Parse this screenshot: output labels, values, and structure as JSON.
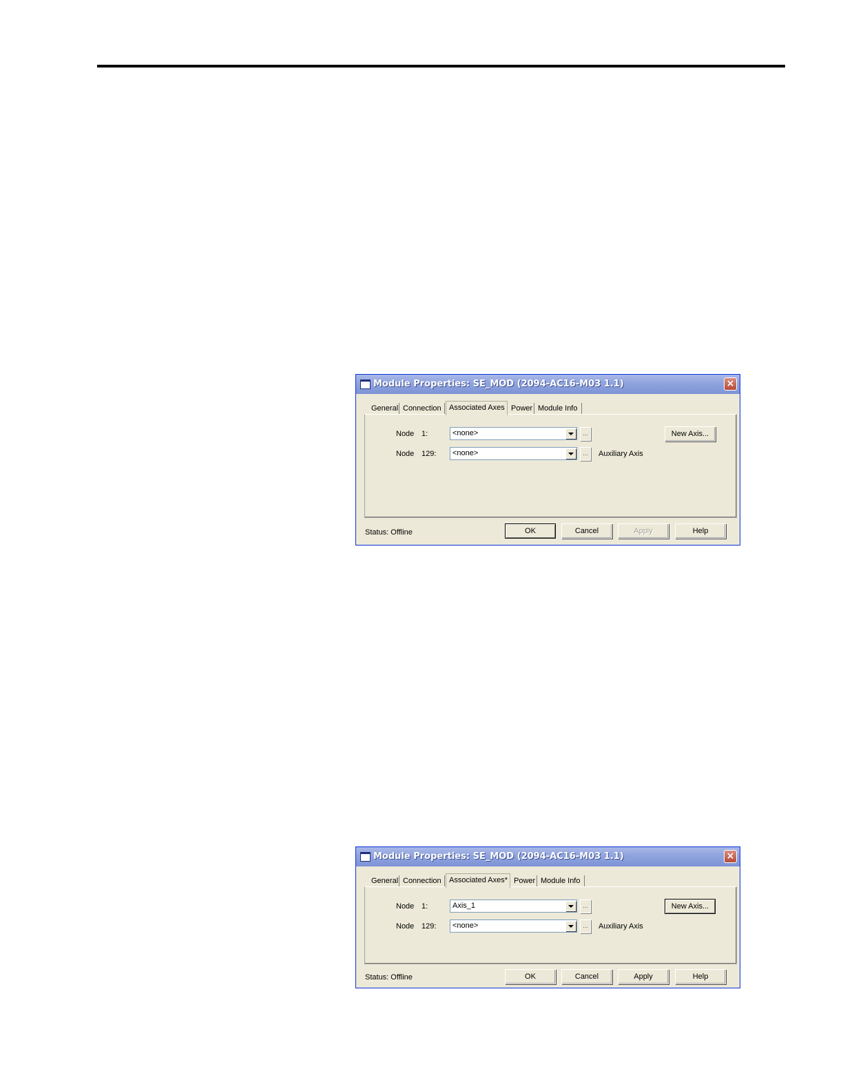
{
  "dialogs": [
    {
      "title": "Module Properties: SE_MOD (2094-AC16-M03 1.1)",
      "tabs": [
        "General",
        "Connection",
        "Associated Axes",
        "Power",
        "Module Info"
      ],
      "node1": {
        "label": "Node",
        "number": "1:",
        "value": "<none>"
      },
      "node129": {
        "label": "Node",
        "number": "129:",
        "value": "<none>",
        "note": "Auxiliary Axis"
      },
      "new_axis_label": "New Axis...",
      "ellipsis": "...",
      "status": "Status:  Offline",
      "buttons": {
        "ok": "OK",
        "cancel": "Cancel",
        "apply": "Apply",
        "help": "Help"
      },
      "close": "×"
    },
    {
      "title": "Module Properties: SE_MOD (2094-AC16-M03 1.1)",
      "tabs": [
        "General",
        "Connection",
        "Associated Axes*",
        "Power",
        "Module Info"
      ],
      "node1": {
        "label": "Node",
        "number": "1:",
        "value": "Axis_1"
      },
      "node129": {
        "label": "Node",
        "number": "129:",
        "value": "<none>",
        "note": "Auxiliary Axis"
      },
      "new_axis_label": "New Axis...",
      "ellipsis": "...",
      "status": "Status:  Offline",
      "buttons": {
        "ok": "OK",
        "cancel": "Cancel",
        "apply": "Apply",
        "help": "Help"
      },
      "close": "×"
    }
  ]
}
